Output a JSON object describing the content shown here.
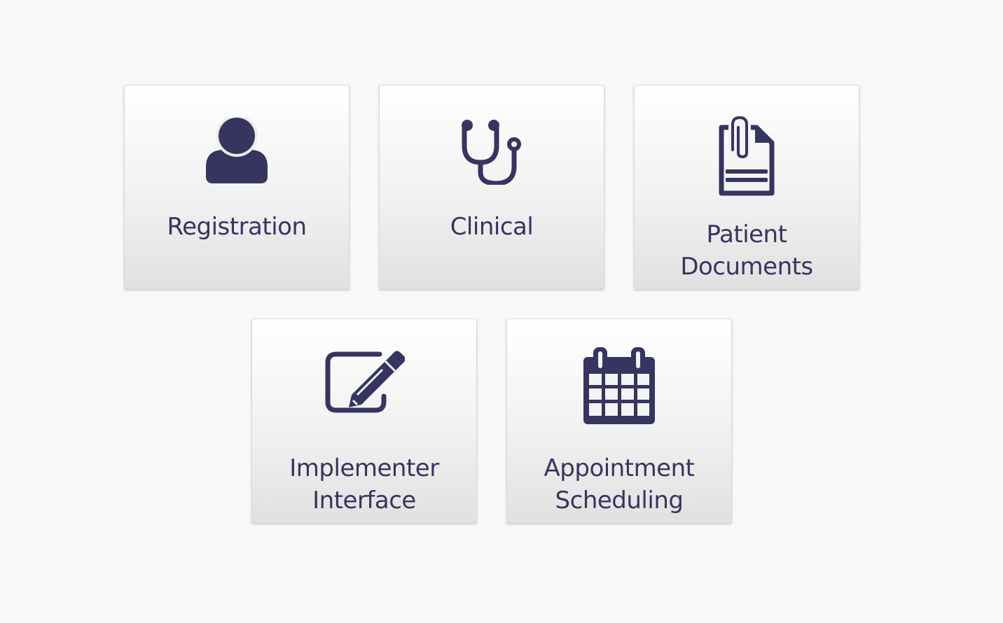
{
  "colors": {
    "background": "#f8f8f8",
    "tile_top": "#ffffff",
    "tile_bottom": "#e1e1e1",
    "icon_and_text": "#363560"
  },
  "apps": [
    {
      "label_lines": [
        "Registration"
      ],
      "icon": "user-icon"
    },
    {
      "label_lines": [
        "Clinical"
      ],
      "icon": "stethoscope-icon"
    },
    {
      "label_lines": [
        "Patient",
        "Documents"
      ],
      "icon": "attached-document-icon"
    },
    {
      "label_lines": [
        "Implementer",
        "Interface"
      ],
      "icon": "edit-pencil-icon"
    },
    {
      "label_lines": [
        "Appointment",
        "Scheduling"
      ],
      "icon": "calendar-icon"
    }
  ]
}
